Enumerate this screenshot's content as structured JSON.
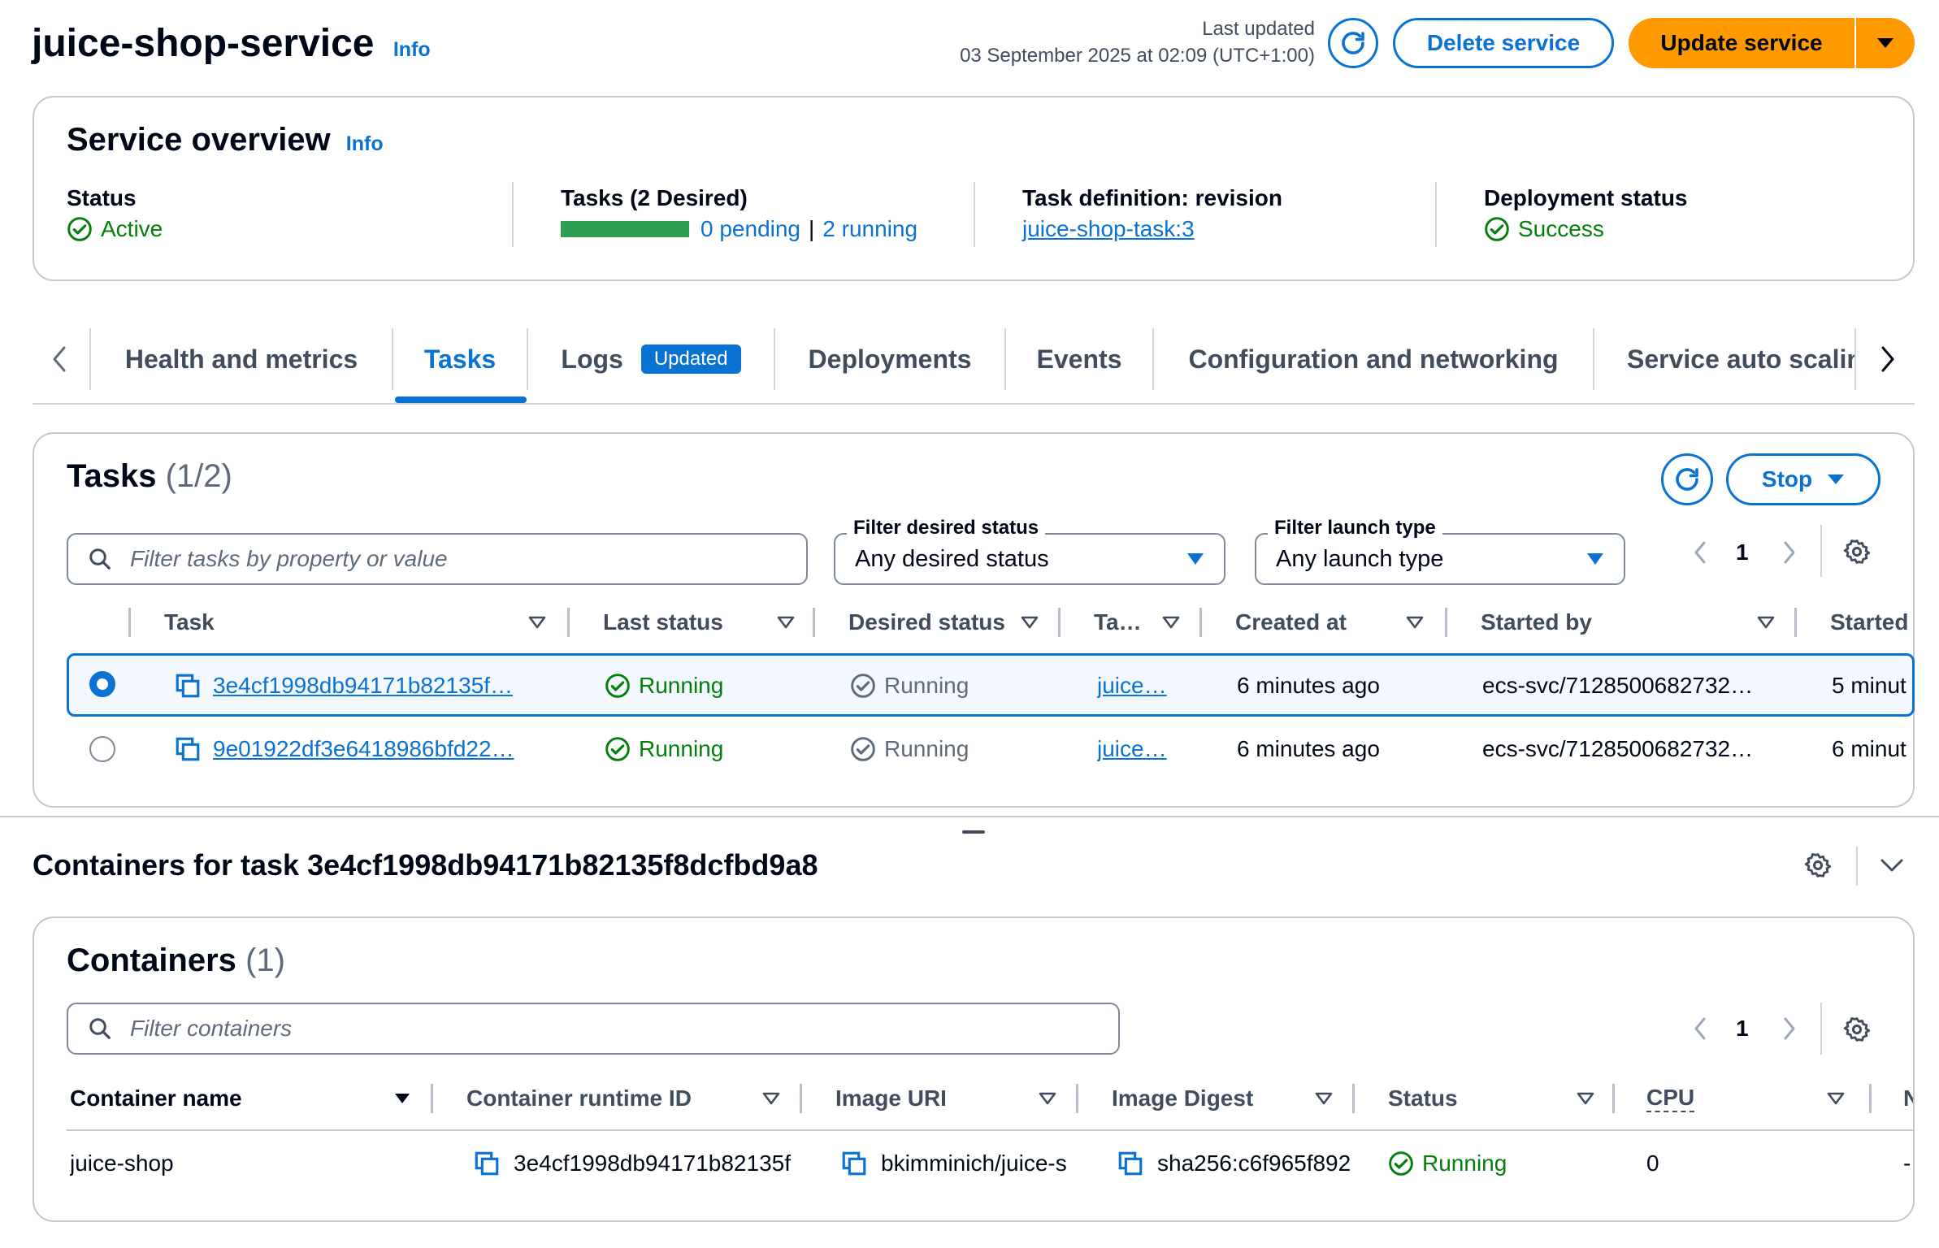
{
  "header": {
    "title": "juice-shop-service",
    "info": "Info",
    "last_updated_label": "Last updated",
    "last_updated_value": "03 September 2025 at 02:09 (UTC+1:00)",
    "delete_label": "Delete service",
    "update_label": "Update service"
  },
  "overview": {
    "title": "Service overview",
    "info": "Info",
    "status_label": "Status",
    "status_value": "Active",
    "tasks_label": "Tasks (2 Desired)",
    "tasks_pending": "0 pending",
    "tasks_sep": "|",
    "tasks_running": "2 running",
    "tasks_running_fraction": 1.0,
    "taskdef_label": "Task definition: revision",
    "taskdef_value": "juice-shop-task:3",
    "deploy_label": "Deployment status",
    "deploy_value": "Success"
  },
  "tabs": [
    {
      "label": "Health and metrics"
    },
    {
      "label": "Tasks",
      "active": true
    },
    {
      "label": "Logs",
      "badge": "Updated"
    },
    {
      "label": "Deployments"
    },
    {
      "label": "Events"
    },
    {
      "label": "Configuration and networking"
    },
    {
      "label": "Service auto scalin"
    }
  ],
  "tasks": {
    "title": "Tasks",
    "count": "(1/2)",
    "stop_label": "Stop",
    "search_placeholder": "Filter tasks by property or value",
    "filter_desired_label": "Filter desired status",
    "filter_desired_value": "Any desired status",
    "filter_launch_label": "Filter launch type",
    "filter_launch_value": "Any launch type",
    "page": "1",
    "columns": [
      "Task",
      "Last status",
      "Desired status",
      "Ta…",
      "Created at",
      "Started by",
      "Started"
    ],
    "rows": [
      {
        "task": "3e4cf1998db94171b82135f…",
        "last_status": "Running",
        "desired_status": "Running",
        "taskdef": "juice…",
        "created": "6 minutes ago",
        "started_by": "ecs-svc/7128500682732…",
        "started": "5 minut",
        "selected": true
      },
      {
        "task": "9e01922df3e6418986bfd22…",
        "last_status": "Running",
        "desired_status": "Running",
        "taskdef": "juice…",
        "created": "6 minutes ago",
        "started_by": "ecs-svc/7128500682732…",
        "started": "6 minut",
        "selected": false
      }
    ]
  },
  "containers_panel": {
    "title": "Containers for task 3e4cf1998db94171b82135f8dcfbd9a8"
  },
  "containers": {
    "title": "Containers",
    "count": "(1)",
    "search_placeholder": "Filter containers",
    "page": "1",
    "columns": [
      "Container name",
      "Container runtime ID",
      "Image URI",
      "Image Digest",
      "Status",
      "CPU",
      "N"
    ],
    "rows": [
      {
        "name": "juice-shop",
        "runtime_id": "3e4cf1998db94171b82135f",
        "image_uri": "bkimminich/juice-s",
        "digest": "sha256:c6f965f892",
        "status": "Running",
        "cpu": "0",
        "extra": "-"
      }
    ]
  },
  "colors": {
    "accent": "#0972d3",
    "primary": "#ff9900",
    "success": "#037f0c",
    "progress": "#2e9e4f"
  }
}
